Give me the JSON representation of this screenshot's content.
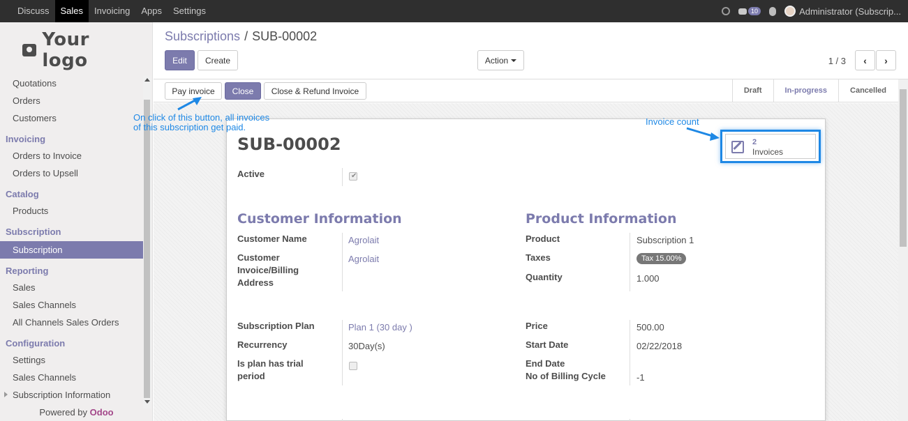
{
  "topnav": {
    "items": [
      "Discuss",
      "Sales",
      "Invoicing",
      "Apps",
      "Settings"
    ],
    "active": "Sales",
    "messages_count": "10",
    "user": "Administrator (Subscrip..."
  },
  "sidebar": {
    "logo": "Your logo",
    "entries": [
      {
        "type": "item",
        "label": "Quotations"
      },
      {
        "type": "item",
        "label": "Orders"
      },
      {
        "type": "item",
        "label": "Customers"
      },
      {
        "type": "head",
        "label": "Invoicing"
      },
      {
        "type": "item",
        "label": "Orders to Invoice"
      },
      {
        "type": "item",
        "label": "Orders to Upsell"
      },
      {
        "type": "head",
        "label": "Catalog"
      },
      {
        "type": "item",
        "label": "Products"
      },
      {
        "type": "head",
        "label": "Subscription"
      },
      {
        "type": "item",
        "label": "Subscription",
        "active": true
      },
      {
        "type": "head",
        "label": "Reporting"
      },
      {
        "type": "item",
        "label": "Sales"
      },
      {
        "type": "item",
        "label": "Sales Channels"
      },
      {
        "type": "item",
        "label": "All Channels Sales Orders"
      },
      {
        "type": "head",
        "label": "Configuration"
      },
      {
        "type": "item",
        "label": "Settings"
      },
      {
        "type": "item",
        "label": "Sales Channels"
      },
      {
        "type": "item",
        "label": "Subscription Information",
        "collapsible": true
      }
    ],
    "powered_by": "Powered by",
    "brand": "Odoo"
  },
  "control": {
    "breadcrumb_parent": "Subscriptions",
    "breadcrumb_sep": "/",
    "breadcrumb_current": "SUB-00002",
    "edit_label": "Edit",
    "create_label": "Create",
    "action_label": "Action",
    "pager": "1 / 3"
  },
  "statusbar": {
    "pay_invoice_label": "Pay invoice",
    "close_label": "Close",
    "close_refund_label": "Close & Refund Invoice",
    "stages": [
      "Draft",
      "In-progress",
      "Cancelled"
    ],
    "current_stage": "In-progress"
  },
  "record": {
    "title": "SUB-00002",
    "active_label": "Active",
    "active_value": true,
    "customer_section": "Customer Information",
    "customer_name_label": "Customer Name",
    "customer_name": "Agrolait",
    "customer_address_label_1": "Customer",
    "customer_address_label_2": "Invoice/Billing",
    "customer_address_label_3": "Address",
    "customer_address": "Agrolait",
    "product_section": "Product Information",
    "product_label": "Product",
    "product": "Subscription 1",
    "taxes_label": "Taxes",
    "taxes": "Tax 15.00%",
    "quantity_label": "Quantity",
    "quantity": "1.000",
    "plan_label": "Subscription Plan",
    "plan": "Plan 1 (30 day )",
    "recurrency_label": "Recurrency",
    "recurrency": "30Day(s)",
    "trial_label_1": "Is plan has trial",
    "trial_label_2": "period",
    "trial_value": false,
    "price_label": "Price",
    "price": "500.00",
    "start_date_label": "Start Date",
    "start_date": "02/22/2018",
    "end_date_label": "End Date",
    "billing_cycle_label": "No of Billing Cycle",
    "billing_cycle": "-1",
    "invoice_count": "2",
    "invoice_label": "Invoices"
  },
  "annotations": {
    "pay_note_1": "On click of this button, all invoices",
    "pay_note_2": "of this subscription get paid.",
    "invoice_note": "Invoice count",
    "color": "#1e88e5"
  }
}
